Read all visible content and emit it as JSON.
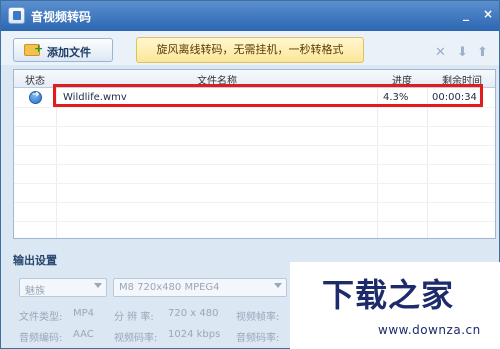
{
  "window": {
    "title": "音视频转码",
    "controls": {
      "minimize": "_",
      "close": "×"
    }
  },
  "toolbar": {
    "add_file_label": "添加文件",
    "promo_text": "旋风离线转码，无需挂机，一秒转格式",
    "icons": [
      "delete-icon",
      "move-down-icon",
      "move-up-icon"
    ]
  },
  "file_list": {
    "columns": [
      "状态",
      "文件名称",
      "进度",
      "剩余时间"
    ],
    "rows": [
      {
        "status_icon": "play-arrow-icon",
        "name": "Wildlife.wmv",
        "progress": "4.3%",
        "remaining": "00:00:34"
      }
    ]
  },
  "output_settings": {
    "title": "输出设置",
    "preset": "魅族",
    "format": "M8 720x480 MPEG4",
    "file_type_label": "文件类型:",
    "file_type_value": "MP4",
    "resolution_label": "分 辨 率:",
    "resolution_value": "720 x 480",
    "video_fps_label": "视频帧率:",
    "audio_codec_label": "音频编码:",
    "audio_codec_value": "AAC",
    "video_bitrate_label": "视频码率:",
    "video_bitrate_value": "1024 kbps",
    "audio_bitrate_label": "音频码率:"
  },
  "watermark": {
    "logo": "下载之家",
    "url": "www.downza.cn"
  },
  "colors": {
    "titlebar": "#2c66b2",
    "highlight": "#e11c1c",
    "promo_bg": "#fbe79a"
  }
}
